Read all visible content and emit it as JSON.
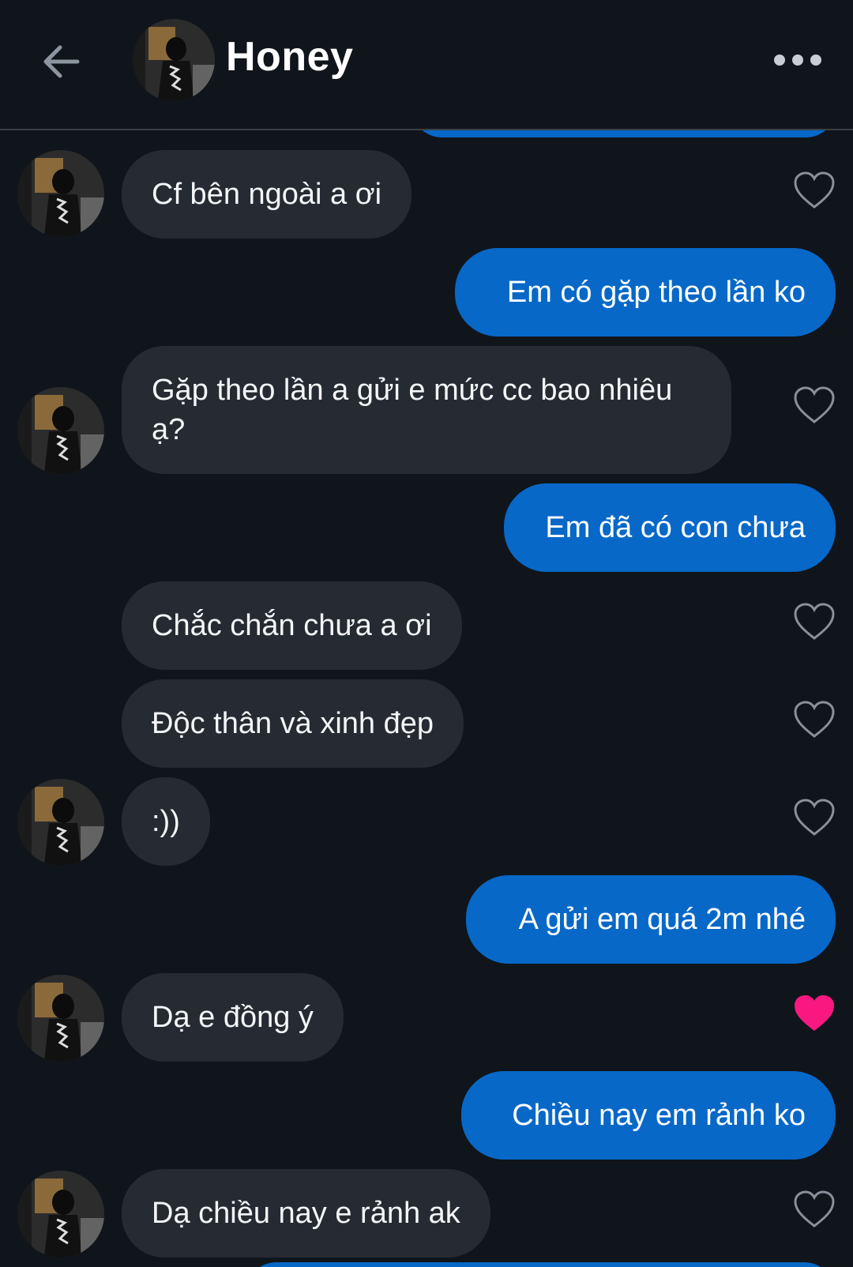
{
  "header": {
    "title": "Honey",
    "back_icon": "arrow-left-icon",
    "more_icon": "more-horizontal-icon"
  },
  "colors": {
    "background": "#10151b",
    "incoming_bubble": "#252a33",
    "outgoing_bubble": "#0768c8",
    "heart_outline": "#8a9099",
    "heart_liked": "#f91880"
  },
  "messages": [
    {
      "id": "m1",
      "side": "in",
      "text": "Cf bên ngoài a ơi",
      "liked": false
    },
    {
      "id": "m2",
      "side": "out",
      "text": "Em có gặp theo lần ko"
    },
    {
      "id": "m3",
      "side": "in",
      "text": "Gặp theo lần a gửi e mức cc bao nhiêu ạ?",
      "liked": false
    },
    {
      "id": "m4",
      "side": "out",
      "text": "Em đã có con chưa"
    },
    {
      "id": "m5",
      "side": "in",
      "text": "Chắc chắn chưa a ơi",
      "liked": false
    },
    {
      "id": "m6",
      "side": "in",
      "text": "Độc thân và xinh đẹp",
      "liked": false
    },
    {
      "id": "m7",
      "side": "in",
      "text": ":))",
      "liked": false
    },
    {
      "id": "m8",
      "side": "out",
      "text": "A gửi em quá 2m nhé"
    },
    {
      "id": "m9",
      "side": "in",
      "text": "Dạ e đồng ý",
      "liked": true
    },
    {
      "id": "m10",
      "side": "out",
      "text": "Chiều nay em rảnh ko"
    },
    {
      "id": "m11",
      "side": "in",
      "text": "Dạ chiều nay e rảnh ak",
      "liked": false
    }
  ]
}
